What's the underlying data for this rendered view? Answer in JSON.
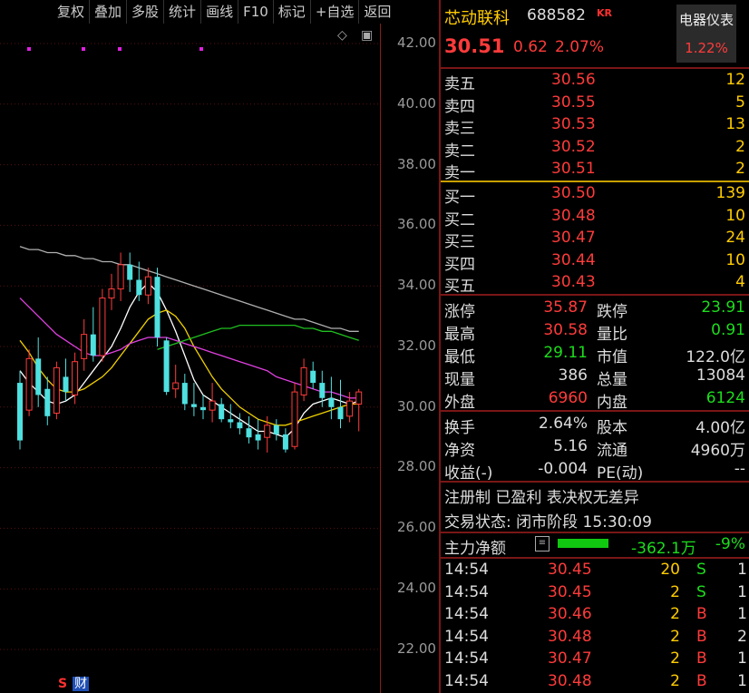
{
  "toolbar": [
    "复权",
    "叠加",
    "多股",
    "统计",
    "画线",
    "F10",
    "标记",
    "+自选",
    "返回"
  ],
  "axis": {
    "labels": [
      "42.00",
      "40.00",
      "38.00",
      "36.00",
      "34.00",
      "32.00",
      "30.00",
      "28.00",
      "26.00",
      "24.00",
      "22.00"
    ]
  },
  "bottom_badges": {
    "s": "S",
    "cai": "财"
  },
  "stock": {
    "name": "芯动联科",
    "code": "688582",
    "tag": "KR",
    "price": "30.51",
    "change": "0.62",
    "change_pct": "2.07%"
  },
  "sector": {
    "name": "电器仪表",
    "pct": "1.22%"
  },
  "order_book": {
    "asks": [
      {
        "label": "卖五",
        "price": "30.56",
        "volume": "12"
      },
      {
        "label": "卖四",
        "price": "30.55",
        "volume": "5"
      },
      {
        "label": "卖三",
        "price": "30.53",
        "volume": "13"
      },
      {
        "label": "卖二",
        "price": "30.52",
        "volume": "2"
      },
      {
        "label": "卖一",
        "price": "30.51",
        "volume": "2"
      }
    ],
    "bids": [
      {
        "label": "买一",
        "price": "30.50",
        "volume": "139"
      },
      {
        "label": "买二",
        "price": "30.48",
        "volume": "10"
      },
      {
        "label": "买三",
        "price": "30.47",
        "volume": "24"
      },
      {
        "label": "买四",
        "price": "30.44",
        "volume": "10"
      },
      {
        "label": "买五",
        "price": "30.43",
        "volume": "4"
      }
    ]
  },
  "stats": [
    {
      "l1": "涨停",
      "v1": "35.87",
      "c1": "red",
      "l2": "跌停",
      "v2": "23.91",
      "c2": "green"
    },
    {
      "l1": "最高",
      "v1": "30.58",
      "c1": "red",
      "l2": "量比",
      "v2": "0.91",
      "c2": "green"
    },
    {
      "l1": "最低",
      "v1": "29.11",
      "c1": "green",
      "l2": "市值",
      "v2": "122.0亿",
      "c2": "white"
    },
    {
      "l1": "现量",
      "v1": "386",
      "c1": "white",
      "l2": "总量",
      "v2": "13084",
      "c2": "white"
    },
    {
      "l1": "外盘",
      "v1": "6960",
      "c1": "red",
      "l2": "内盘",
      "v2": "6124",
      "c2": "green"
    }
  ],
  "stats2": [
    {
      "l1": "换手",
      "v1": "2.64%",
      "l2": "股本",
      "v2": "4.00亿"
    },
    {
      "l1": "净资",
      "v1": "5.16",
      "l2": "流通",
      "v2": "4960万"
    },
    {
      "l1": "收益(-)",
      "v1": "-0.004",
      "l2": "PE(动)",
      "v2": "--"
    }
  ],
  "info": {
    "tags": "注册制 已盈利 表决权无差异",
    "status": "交易状态: 闭市阶段 15:30:09"
  },
  "flow": {
    "label": "主力净额",
    "value": "-362.1万",
    "pct": "-9%"
  },
  "ticks": [
    {
      "time": "14:54",
      "price": "30.45",
      "volume": "20",
      "dir": "S",
      "num": "1"
    },
    {
      "time": "14:54",
      "price": "30.45",
      "volume": "2",
      "dir": "S",
      "num": "1"
    },
    {
      "time": "14:54",
      "price": "30.46",
      "volume": "2",
      "dir": "B",
      "num": "1"
    },
    {
      "time": "14:54",
      "price": "30.48",
      "volume": "2",
      "dir": "B",
      "num": "2"
    },
    {
      "time": "14:54",
      "price": "30.47",
      "volume": "2",
      "dir": "B",
      "num": "1"
    },
    {
      "time": "14:54",
      "price": "30.48",
      "volume": "2",
      "dir": "B",
      "num": "1"
    }
  ],
  "colors": {
    "up": "#ff3b3b",
    "down": "#4fe0e0",
    "ma5": "#ffffff",
    "ma10": "#f0d000",
    "ma20": "#e040e0",
    "ma60": "#20c020",
    "ma120": "#b0b0b0",
    "frame": "#7a1616"
  },
  "chart_data": {
    "type": "candlestick",
    "ylim": [
      21.5,
      42.5
    ],
    "y_ticks": [
      42,
      40,
      38,
      36,
      34,
      32,
      30,
      28,
      26,
      24,
      22
    ],
    "candles": [
      {
        "o": 30.8,
        "h": 31.2,
        "l": 28.6,
        "c": 28.9
      },
      {
        "o": 29.9,
        "h": 31.9,
        "l": 29.7,
        "c": 31.6
      },
      {
        "o": 31.6,
        "h": 32.3,
        "l": 30.0,
        "c": 30.4
      },
      {
        "o": 30.6,
        "h": 31.0,
        "l": 29.4,
        "c": 29.7
      },
      {
        "o": 29.8,
        "h": 31.5,
        "l": 29.6,
        "c": 31.3
      },
      {
        "o": 31.0,
        "h": 31.6,
        "l": 30.2,
        "c": 30.5
      },
      {
        "o": 30.4,
        "h": 31.8,
        "l": 30.1,
        "c": 31.5
      },
      {
        "o": 31.6,
        "h": 32.9,
        "l": 31.2,
        "c": 32.4
      },
      {
        "o": 32.4,
        "h": 33.3,
        "l": 31.5,
        "c": 31.7
      },
      {
        "o": 31.7,
        "h": 33.9,
        "l": 31.5,
        "c": 33.6
      },
      {
        "o": 33.6,
        "h": 34.4,
        "l": 33.2,
        "c": 33.9
      },
      {
        "o": 33.9,
        "h": 35.1,
        "l": 33.5,
        "c": 34.7
      },
      {
        "o": 34.7,
        "h": 35.1,
        "l": 33.8,
        "c": 34.2
      },
      {
        "o": 34.2,
        "h": 34.8,
        "l": 33.5,
        "c": 33.7
      },
      {
        "o": 33.7,
        "h": 34.6,
        "l": 33.4,
        "c": 34.3
      },
      {
        "o": 34.3,
        "h": 34.6,
        "l": 32.0,
        "c": 32.3
      },
      {
        "o": 32.2,
        "h": 32.3,
        "l": 30.4,
        "c": 30.5
      },
      {
        "o": 30.6,
        "h": 31.4,
        "l": 30.3,
        "c": 30.8
      },
      {
        "o": 30.8,
        "h": 31.1,
        "l": 29.9,
        "c": 30.1
      },
      {
        "o": 30.1,
        "h": 30.8,
        "l": 29.7,
        "c": 30.0
      },
      {
        "o": 30.0,
        "h": 30.4,
        "l": 29.6,
        "c": 29.9
      },
      {
        "o": 29.9,
        "h": 30.8,
        "l": 29.5,
        "c": 30.2
      },
      {
        "o": 30.1,
        "h": 30.3,
        "l": 29.5,
        "c": 29.6
      },
      {
        "o": 29.6,
        "h": 30.1,
        "l": 29.3,
        "c": 29.5
      },
      {
        "o": 29.5,
        "h": 29.8,
        "l": 29.1,
        "c": 29.3
      },
      {
        "o": 29.3,
        "h": 29.7,
        "l": 28.8,
        "c": 29.0
      },
      {
        "o": 29.1,
        "h": 29.6,
        "l": 28.6,
        "c": 28.9
      },
      {
        "o": 29.0,
        "h": 29.7,
        "l": 28.5,
        "c": 29.4
      },
      {
        "o": 29.4,
        "h": 29.6,
        "l": 28.9,
        "c": 29.1
      },
      {
        "o": 29.1,
        "h": 29.3,
        "l": 28.5,
        "c": 28.6
      },
      {
        "o": 28.7,
        "h": 30.8,
        "l": 28.6,
        "c": 30.5
      },
      {
        "o": 30.4,
        "h": 31.6,
        "l": 30.2,
        "c": 31.3
      },
      {
        "o": 31.2,
        "h": 31.5,
        "l": 30.6,
        "c": 30.8
      },
      {
        "o": 30.8,
        "h": 31.2,
        "l": 30.0,
        "c": 30.3
      },
      {
        "o": 30.3,
        "h": 31.0,
        "l": 29.6,
        "c": 30.0
      },
      {
        "o": 30.0,
        "h": 30.9,
        "l": 29.3,
        "c": 29.6
      },
      {
        "o": 29.7,
        "h": 30.5,
        "l": 29.5,
        "c": 30.2
      },
      {
        "o": 30.1,
        "h": 30.6,
        "l": 29.2,
        "c": 30.5
      }
    ],
    "ma_lines": [
      {
        "name": "MA5",
        "color": "#ffffff",
        "values": [
          31.2,
          30.8,
          30.5,
          30.2,
          30.1,
          30.2,
          30.4,
          30.8,
          31.2,
          31.6,
          32.0,
          32.6,
          33.3,
          33.8,
          34.1,
          33.8,
          33.2,
          32.5,
          31.7,
          30.9,
          30.4,
          30.2,
          30.0,
          29.8,
          29.6,
          29.4,
          29.2,
          29.2,
          29.1,
          29.0,
          29.3,
          29.8,
          30.1,
          30.2,
          30.3,
          30.2,
          30.1,
          30.2
        ]
      },
      {
        "name": "MA10",
        "color": "#f0d000",
        "values": [
          32.2,
          31.8,
          31.3,
          30.9,
          30.6,
          30.5,
          30.5,
          30.6,
          30.8,
          31.0,
          31.3,
          31.7,
          32.1,
          32.5,
          32.9,
          33.1,
          33.2,
          33.0,
          32.6,
          32.0,
          31.5,
          31.0,
          30.6,
          30.3,
          30.0,
          29.8,
          29.6,
          29.5,
          29.4,
          29.4,
          29.5,
          29.6,
          29.7,
          29.8,
          29.9,
          30.0,
          30.1,
          30.1
        ]
      },
      {
        "name": "MA20",
        "color": "#e040e0",
        "values": [
          33.6,
          33.3,
          33.0,
          32.7,
          32.4,
          32.2,
          32.0,
          31.8,
          31.7,
          31.7,
          31.8,
          31.9,
          32.1,
          32.2,
          32.3,
          32.3,
          32.3,
          32.2,
          32.1,
          32.0,
          31.9,
          31.8,
          31.7,
          31.6,
          31.5,
          31.4,
          31.3,
          31.2,
          31.0,
          30.9,
          30.8,
          30.7,
          30.6,
          30.5,
          30.5,
          30.4,
          30.3,
          30.3
        ]
      },
      {
        "name": "MA60",
        "color": "#20c020",
        "values": [
          null,
          null,
          null,
          null,
          null,
          null,
          null,
          null,
          null,
          null,
          null,
          null,
          null,
          null,
          null,
          31.9,
          32.0,
          32.1,
          32.2,
          32.3,
          32.4,
          32.5,
          32.6,
          32.6,
          32.7,
          32.7,
          32.7,
          32.7,
          32.7,
          32.7,
          32.7,
          32.6,
          32.6,
          32.5,
          32.5,
          32.4,
          32.3,
          32.2
        ]
      },
      {
        "name": "MA120",
        "color": "#b0b0b0",
        "values": [
          35.3,
          35.2,
          35.2,
          35.1,
          35.1,
          35.0,
          35.0,
          34.9,
          34.9,
          34.8,
          34.8,
          34.7,
          34.7,
          34.6,
          34.5,
          34.4,
          34.3,
          34.2,
          34.1,
          34.0,
          33.9,
          33.8,
          33.7,
          33.6,
          33.5,
          33.4,
          33.3,
          33.2,
          33.1,
          33.0,
          32.9,
          32.9,
          32.8,
          32.7,
          32.6,
          32.6,
          32.5,
          32.5
        ]
      }
    ],
    "markers": [
      30,
      90,
      130,
      220
    ]
  }
}
